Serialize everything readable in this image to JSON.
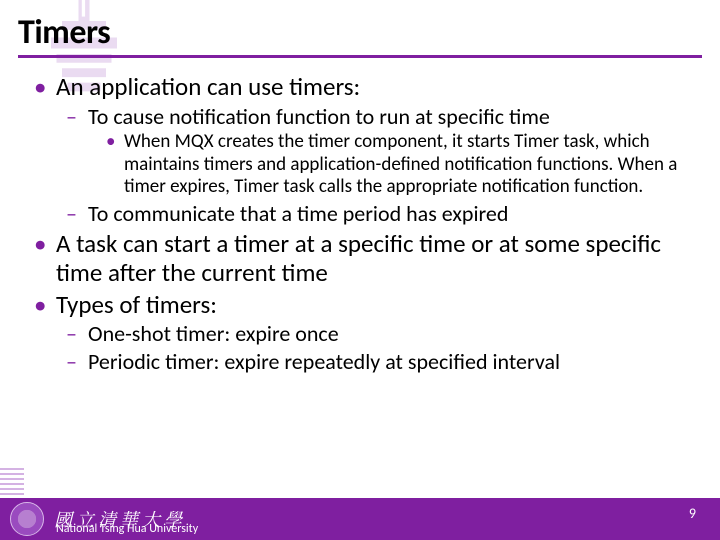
{
  "title": "Timers",
  "bullets": {
    "b1": "An application can use timers:",
    "b1_1": "To cause notification function to run at specific time",
    "b1_1_1": "When MQX creates the timer component, it starts Timer task, which maintains timers and application-defined notification functions. When a timer expires, Timer task calls the appropriate notification function.",
    "b1_2": "To communicate that a time period has expired",
    "b2": "A task can start a timer at a specific time or at some specific time after the current time",
    "b3": "Types of timers:",
    "b3_1": "One-shot timer: expire once",
    "b3_2": "Periodic timer: expire repeatedly at specified interval"
  },
  "footer": {
    "calligraphy": "國立清華大學",
    "university": "National Tsing Hua University",
    "page": "9"
  }
}
